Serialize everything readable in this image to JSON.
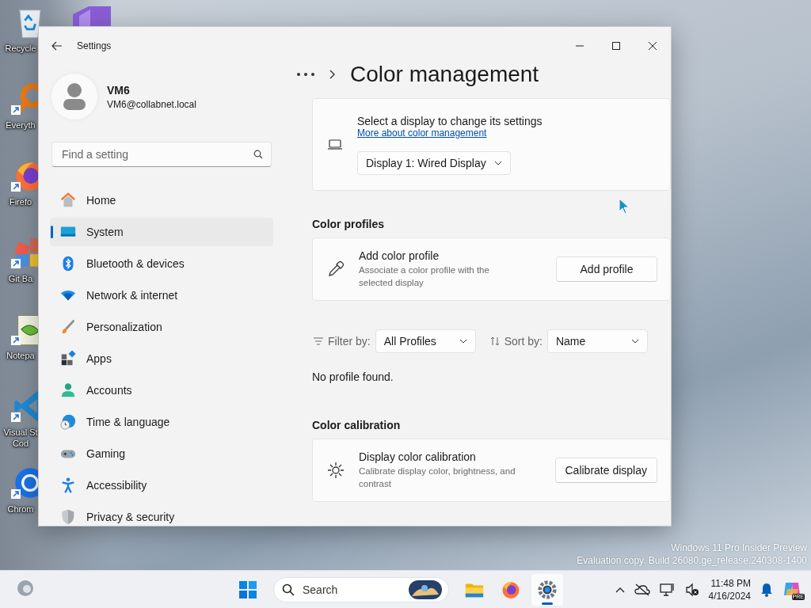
{
  "desktop": {
    "icons": [
      {
        "kind": "recycle",
        "label": "Recycle",
        "shortcut": false
      },
      {
        "kind": "magnifier",
        "label": "Everyth",
        "shortcut": true
      },
      {
        "kind": "firefox",
        "label": "Firefo",
        "shortcut": true
      },
      {
        "kind": "git",
        "label": "Git Ba",
        "shortcut": true
      },
      {
        "kind": "notepad",
        "label": "Notepa",
        "shortcut": true
      },
      {
        "kind": "vscode",
        "label": "Visual St Cod",
        "shortcut": true
      },
      {
        "kind": "chrome",
        "label": "Chrom",
        "shortcut": true
      }
    ],
    "watermark": [
      "Windows 11 Pro Insider Preview",
      "Evaluation copy. Build 26080.ge_release.240308-1400"
    ]
  },
  "window": {
    "title": "Settings",
    "user": {
      "name": "VM6",
      "email": "VM6@collabnet.local"
    },
    "search": {
      "placeholder": "Find a setting"
    },
    "nav": [
      {
        "kind": "home",
        "label": "Home",
        "selected": false
      },
      {
        "kind": "system",
        "label": "System",
        "selected": true
      },
      {
        "kind": "bluetooth",
        "label": "Bluetooth & devices",
        "selected": false
      },
      {
        "kind": "network",
        "label": "Network & internet",
        "selected": false
      },
      {
        "kind": "brush",
        "label": "Personalization",
        "selected": false
      },
      {
        "kind": "apps",
        "label": "Apps",
        "selected": false
      },
      {
        "kind": "accounts",
        "label": "Accounts",
        "selected": false
      },
      {
        "kind": "time",
        "label": "Time & language",
        "selected": false
      },
      {
        "kind": "gaming",
        "label": "Gaming",
        "selected": false
      },
      {
        "kind": "accessibility",
        "label": "Accessibility",
        "selected": false
      },
      {
        "kind": "privacy",
        "label": "Privacy & security",
        "selected": false
      }
    ],
    "page_title": "Color management",
    "display_card": {
      "prompt": "Select a display to change its settings",
      "link": "More about color management",
      "dropdown": "Display 1: Wired Display"
    },
    "color_profiles": {
      "heading": "Color profiles",
      "card": {
        "title": "Add color profile",
        "description": "Associate a color profile with the selected display",
        "button": "Add profile"
      },
      "filter": {
        "label": "Filter by:",
        "value": "All Profiles"
      },
      "sort": {
        "label": "Sort by:",
        "value": "Name"
      },
      "empty": "No profile found."
    },
    "color_calibration": {
      "heading": "Color calibration",
      "card": {
        "title": "Display color calibration",
        "description": "Calibrate display color, brightness, and contrast",
        "button": "Calibrate display"
      }
    }
  },
  "taskbar": {
    "search": {
      "placeholder": "Search"
    },
    "apps": [
      {
        "kind": "explorer",
        "selected": false
      },
      {
        "kind": "firefox",
        "selected": false
      },
      {
        "kind": "settings",
        "selected": true
      }
    ],
    "time": "11:48 PM",
    "date": "4/16/2024",
    "copilot_badge": "PRE"
  }
}
